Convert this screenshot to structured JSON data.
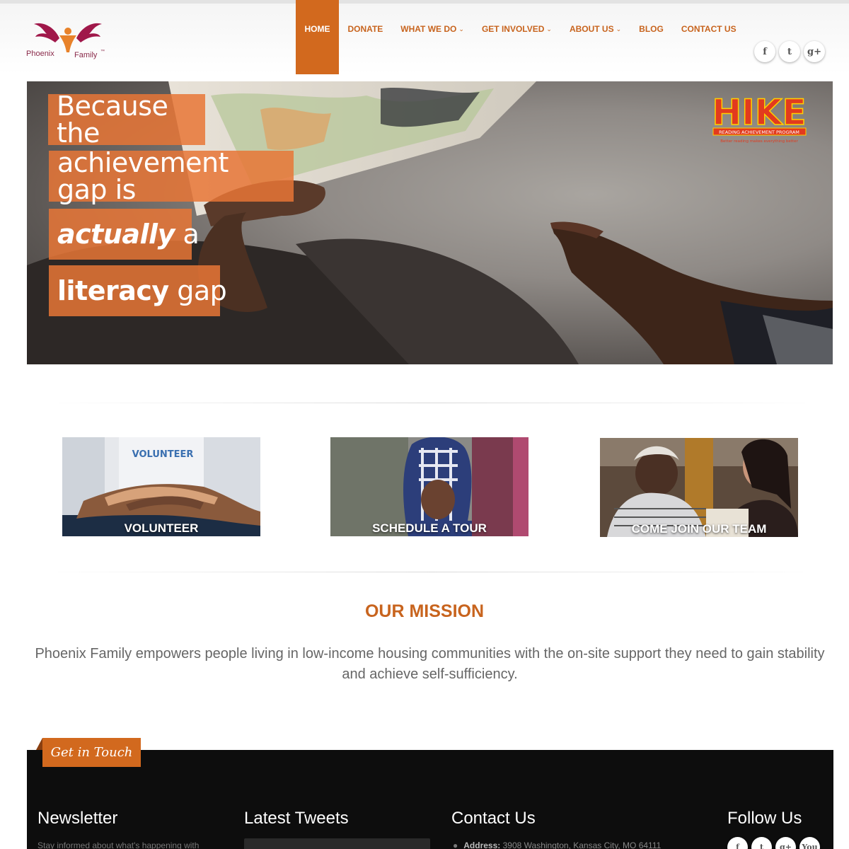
{
  "brand": {
    "logo_word_1": "Phoenix",
    "logo_word_2": "Family",
    "logo_tm": "™"
  },
  "nav": {
    "items": [
      {
        "label": "HOME",
        "active": true,
        "dropdown": false
      },
      {
        "label": "DONATE",
        "active": false,
        "dropdown": false
      },
      {
        "label": "WHAT WE DO",
        "active": false,
        "dropdown": true
      },
      {
        "label": "GET INVOLVED",
        "active": false,
        "dropdown": true
      },
      {
        "label": "ABOUT US",
        "active": false,
        "dropdown": true
      },
      {
        "label": "BLOG",
        "active": false,
        "dropdown": false
      },
      {
        "label": "CONTACT US",
        "active": false,
        "dropdown": false
      }
    ],
    "caret": "⌄"
  },
  "social_top": [
    {
      "icon": "facebook-icon",
      "glyph": "f"
    },
    {
      "icon": "twitter-icon",
      "glyph": "t"
    },
    {
      "icon": "google-plus-icon",
      "glyph": "g+"
    }
  ],
  "hero": {
    "line1": "Because the",
    "line2": "achievement gap is",
    "line3_emph": "actually",
    "line3_rest": " a",
    "line4_emph": "literacy",
    "line4_rest": " gap",
    "hike": {
      "word": "HIKE",
      "banner": "READING ACHIEVEMENT PROGRAM",
      "slogan": "Better reading makes everything better"
    }
  },
  "tiles": [
    {
      "caption": "VOLUNTEER"
    },
    {
      "caption": "SCHEDULE A TOUR"
    },
    {
      "caption": "COME JOIN OUR TEAM"
    }
  ],
  "mission": {
    "title": "OUR MISSION",
    "text": "Phoenix Family empowers people living in low-income housing communities with the on-site support they need to gain stability and achieve self-sufficiency."
  },
  "footer": {
    "flag": "Get in Touch",
    "newsletter_title": "Newsletter",
    "newsletter_text": "Stay informed about what's happening with",
    "tweets_title": "Latest Tweets",
    "contact_title": "Contact Us",
    "address_label": "Address:",
    "address_value": "3908 Washington, Kansas City, MO 64111",
    "follow_title": "Follow Us",
    "follow": [
      {
        "icon": "facebook-icon",
        "glyph": "f"
      },
      {
        "icon": "twitter-icon",
        "glyph": "t"
      },
      {
        "icon": "google-plus-icon",
        "glyph": "g+"
      },
      {
        "icon": "youtube-icon",
        "glyph": "You"
      }
    ]
  },
  "colors": {
    "accent": "#d2691e",
    "nav_text": "#c8641e",
    "footer_bg": "#0d0d0d"
  }
}
